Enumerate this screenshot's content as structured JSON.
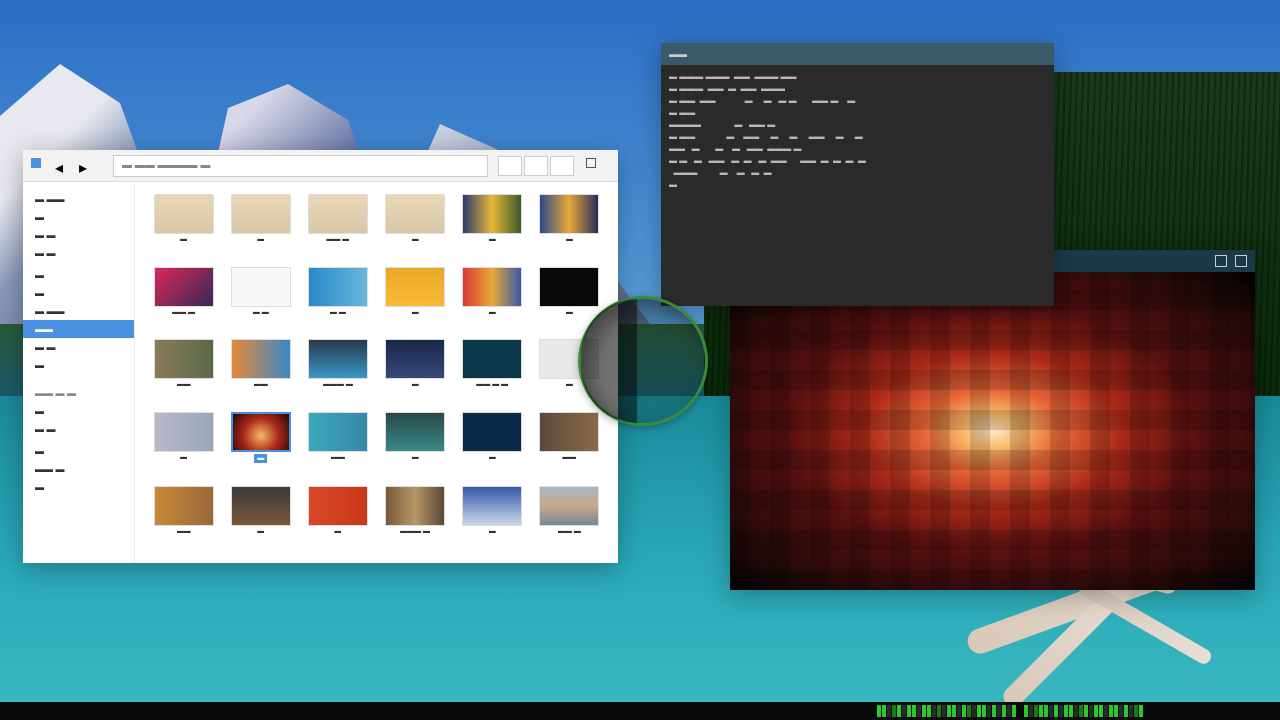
{
  "fileManager": {
    "path": "▬ ▬▬ ▬▬▬▬ ▬",
    "sidebar": [
      {
        "label": "▬ ▬▬",
        "type": "item"
      },
      {
        "label": "▬",
        "type": "item"
      },
      {
        "label": "▬ ▬",
        "type": "item"
      },
      {
        "label": "▬ ▬",
        "type": "item"
      },
      {
        "label": "",
        "type": "sp"
      },
      {
        "label": "▬",
        "type": "item"
      },
      {
        "label": "▬",
        "type": "item"
      },
      {
        "label": "▬ ▬▬",
        "type": "item"
      },
      {
        "label": "▬▬",
        "type": "item",
        "selected": true
      },
      {
        "label": "▬ ▬",
        "type": "item"
      },
      {
        "label": "▬",
        "type": "item"
      },
      {
        "label": "",
        "type": "sp"
      },
      {
        "label": "▬▬ ▬ ▬",
        "type": "head"
      },
      {
        "label": "▬",
        "type": "item"
      },
      {
        "label": "▬ ▬",
        "type": "item"
      },
      {
        "label": "",
        "type": "sp"
      },
      {
        "label": "▬",
        "type": "item"
      },
      {
        "label": "▬▬ ▬",
        "type": "item"
      },
      {
        "label": "▬",
        "type": "item"
      }
    ],
    "items": [
      {
        "label": "▬",
        "thumb": "folder"
      },
      {
        "label": "▬",
        "thumb": "folder"
      },
      {
        "label": "▬▬ ▬",
        "thumb": "folder"
      },
      {
        "label": "▬",
        "thumb": "folder"
      },
      {
        "label": "▬",
        "thumb": "linear-gradient(90deg,#2a3a6a,#e8b838,#3a5a2a)"
      },
      {
        "label": "▬",
        "thumb": "linear-gradient(90deg,#2a4a8a,#e8a838,#2a2a5a)"
      },
      {
        "label": "▬▬ ▬",
        "thumb": "linear-gradient(135deg,#d82858,#382858)"
      },
      {
        "label": "▬ ▬",
        "thumb": "#f8f8f8"
      },
      {
        "label": "▬ ▬",
        "thumb": "linear-gradient(90deg,#2888c8,#68b8d8)"
      },
      {
        "label": "▬",
        "thumb": "linear-gradient(to bottom,#e8a828,#f8b838)"
      },
      {
        "label": "▬",
        "thumb": "linear-gradient(90deg,#d83838,#e8a838,#3858a8)"
      },
      {
        "label": "▬",
        "thumb": "#080808"
      },
      {
        "label": "▬▬",
        "thumb": "linear-gradient(90deg,#8a7a5a,#5a6a4a)"
      },
      {
        "label": "▬▬",
        "thumb": "linear-gradient(90deg,#e88838,#3888c8)"
      },
      {
        "label": "▬▬▬ ▬",
        "thumb": "linear-gradient(to bottom,#283848,#3898c8)"
      },
      {
        "label": "▬",
        "thumb": "linear-gradient(to bottom,#182848,#38487a)"
      },
      {
        "label": "▬▬ ▬ ▬",
        "thumb": "#0a3848"
      },
      {
        "label": "▬",
        "thumb": "#e8e8e8"
      },
      {
        "label": "▬",
        "thumb": "linear-gradient(90deg,#b8b8c8,#98a8b8)"
      },
      {
        "label": "▬",
        "thumb": "radial-gradient(circle at 50% 60%,#f8b868,#a82818,#200808)",
        "selected": true
      },
      {
        "label": "▬▬",
        "thumb": "linear-gradient(90deg,#3aa8b8,#3888a8)"
      },
      {
        "label": "▬",
        "thumb": "linear-gradient(to bottom,#284848,#3a8888)"
      },
      {
        "label": "▬",
        "thumb": "#0a2848"
      },
      {
        "label": "▬▬",
        "thumb": "linear-gradient(90deg,#5a4a3a,#8a6a4a)"
      },
      {
        "label": "▬▬",
        "thumb": "linear-gradient(90deg,#c88838,#986838)"
      },
      {
        "label": "▬",
        "thumb": "linear-gradient(to bottom,#3a3a3a,#7a5838)"
      },
      {
        "label": "▬",
        "thumb": "linear-gradient(90deg,#d84828,#c83818)"
      },
      {
        "label": "▬▬▬ ▬",
        "thumb": "linear-gradient(90deg,#785838,#b89868,#584838)"
      },
      {
        "label": "▬",
        "thumb": "linear-gradient(to bottom,#3858a8,#c8d8e8)"
      },
      {
        "label": "▬▬ ▬",
        "thumb": "linear-gradient(to bottom,#a8b8c8,#c8a888,#788898)"
      }
    ]
  },
  "terminal": {
    "title": "▬▬",
    "lines": [
      "▬ ▬▬▬ ▬▬▬  ▬▬  ▬▬▬ ▬▬",
      "▬ ▬▬▬  ▬▬  ▬  ▬▬  ▬▬▬ ",
      "▬ ▬▬  ▬▬             ▬     ▬   ▬ ▬       ▬▬ ▬    ▬",
      "▬ ▬▬  ",
      "▬▬▬▬               ▬   ▬▬ ▬",
      "▬ ▬▬              ▬    ▬▬     ▬     ▬     ▬▬     ▬     ▬",
      "▬▬   ▬       ▬    ▬   ▬▬  ▬▬▬ ▬",
      "▬ ▬   ▬   ▬▬   ▬  ▬   ▬  ▬▬      ▬▬  ▬  ▬  ▬  ▬",
      "  ▬▬▬          ▬    ▬   ▬  ▬",
      "▬"
    ]
  },
  "imageViewer": {
    "title": "",
    "minimize": "▬",
    "close": "▬"
  }
}
